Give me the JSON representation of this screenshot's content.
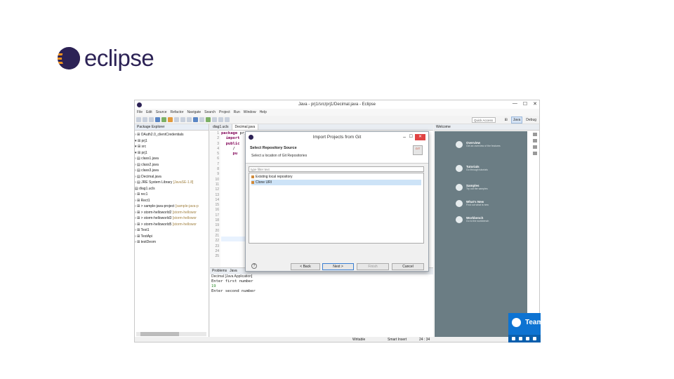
{
  "logo": {
    "text": "eclipse"
  },
  "window": {
    "title": "Java - prj1/src/prj1/Decimal.java - Eclipse",
    "controls": {
      "minimize": "—",
      "maximize": "☐",
      "close": "✕"
    }
  },
  "menu": [
    "File",
    "Edit",
    "Source",
    "Refactor",
    "Navigate",
    "Search",
    "Project",
    "Run",
    "Window",
    "Help"
  ],
  "toolbar": {
    "quick_access": "Quick Access",
    "perspective_java": "Java",
    "perspective_debug": "Debug"
  },
  "package_explorer": {
    "title": "Package Explorer",
    "items": [
      {
        "text": "› ⊞ OAuth2.0_clientCredentials",
        "dec": ""
      },
      {
        "text": "▾ ⊞ prj1",
        "dec": ""
      },
      {
        "text": "   ▾ ⊞ src",
        "dec": ""
      },
      {
        "text": "      ▾ ⊞ prj1",
        "dec": ""
      },
      {
        "text": "         › ▤ class1.java",
        "dec": ""
      },
      {
        "text": "         › ▤ class2.java",
        "dec": ""
      },
      {
        "text": "         › ▤ class3.java",
        "dec": ""
      },
      {
        "text": "         › ▤ Decimal.java",
        "dec": ""
      },
      {
        "text": "   › ▤ JRE System Library ",
        "dec": "[JavaSE-1.8]"
      },
      {
        "text": "      ▤ diag1.ucls",
        "dec": ""
      },
      {
        "text": "› ⊞ rec1",
        "dec": ""
      },
      {
        "text": "› ⊞ Rect1",
        "dec": ""
      },
      {
        "text": "› ⊞ > sample-java-project ",
        "dec": "[sample-java-p"
      },
      {
        "text": "› ⊞ > storm-helloworld2 ",
        "dec": "[storm-hellowor"
      },
      {
        "text": "› ⊞ > storm-helloworld3 ",
        "dec": "[storm-hellowor"
      },
      {
        "text": "› ⊞ > storm-helloworld5 ",
        "dec": "[storm-hellowor"
      },
      {
        "text": "› ⊞ Test1",
        "dec": ""
      },
      {
        "text": "› ⊞ TestApi",
        "dec": ""
      },
      {
        "text": "› ⊞ testDeom",
        "dec": ""
      }
    ]
  },
  "editor": {
    "tabs": [
      "diag1.ucls",
      "Decimal.java"
    ],
    "line_numbers": [
      "1",
      "2",
      "3",
      "4",
      "5",
      "6",
      "7",
      "8",
      "9",
      "10",
      "11",
      "12",
      "13",
      "14",
      "15",
      "16",
      "17",
      "18",
      "19",
      "20",
      "21",
      "22",
      "23",
      "24",
      "25"
    ],
    "code_lines": [
      {
        "kw": "package",
        "rest": " prj1"
      },
      {
        "kw": "",
        "rest": ""
      },
      {
        "kw": "  import",
        "rest": ""
      },
      {
        "kw": "",
        "rest": ""
      },
      {
        "kw": "  public",
        "rest": ""
      },
      {
        "kw": "",
        "rest": "     /"
      },
      {
        "kw": "",
        "rest": ""
      },
      {
        "kw": "",
        "rest": ""
      },
      {
        "kw": "     pu",
        "rest": ""
      }
    ]
  },
  "console": {
    "tabs": [
      "Problems",
      "Java"
    ],
    "info": "Decimal [Java Application]",
    "prompt1": "Enter first number",
    "input1": "19",
    "prompt2": "Enter second number"
  },
  "welcome": {
    "tab": "Welcome",
    "items": [
      {
        "title": "Overview",
        "sub": "Get an overview of the features"
      },
      {
        "title": "Tutorials",
        "sub": "Go through tutorials"
      },
      {
        "title": "Samples",
        "sub": "Try out the samples"
      },
      {
        "title": "What's New",
        "sub": "Find out what is new"
      },
      {
        "title": "Workbench",
        "sub": "Go to the workbench"
      }
    ]
  },
  "status": {
    "mode": "Writable",
    "insert": "Smart Insert",
    "position": "24 : 34"
  },
  "dialog": {
    "title": "Import Projects from Git",
    "heading": "Select Repository Source",
    "subheading": "Select a location of Git Repositories",
    "filter_placeholder": "type filter text",
    "options": [
      "Existing local repository",
      "Clone URI"
    ],
    "selected_option": "Clone URI",
    "help": "?",
    "buttons": {
      "back": "< Back",
      "next": "Next >",
      "finish": "Finish",
      "cancel": "Cancel"
    }
  },
  "teamviewer": {
    "name": "Team"
  }
}
